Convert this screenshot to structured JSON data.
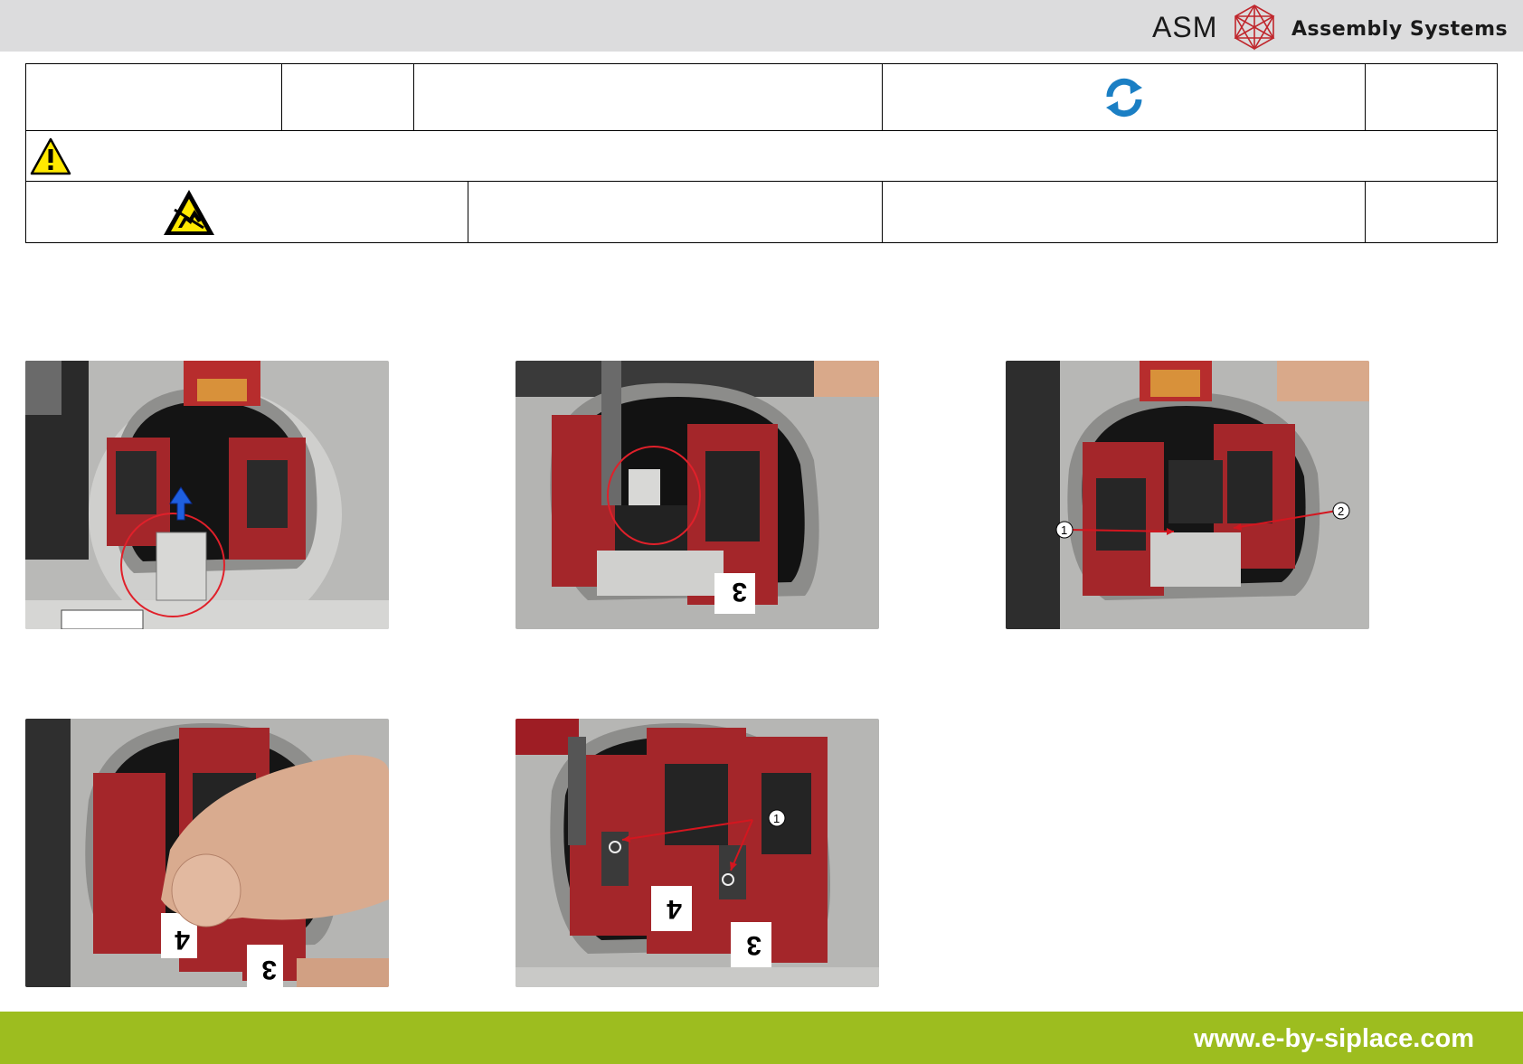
{
  "header": {
    "brand_short": "ASM",
    "brand_name": "Assembly Systems"
  },
  "info_table": {
    "row1": [
      "",
      "",
      "",
      "",
      ""
    ],
    "row1_icon": "refresh-icon",
    "row2_icon": "warning-icon",
    "row3_icon": "esd-warning-icon",
    "row3": [
      "",
      "",
      "",
      ""
    ]
  },
  "photos": [
    {
      "id": "photo-1",
      "callouts": []
    },
    {
      "id": "photo-2",
      "callouts": []
    },
    {
      "id": "photo-3",
      "callouts": [
        "1",
        "2"
      ]
    },
    {
      "id": "photo-4",
      "callouts": []
    },
    {
      "id": "photo-5",
      "callouts": [
        "1"
      ]
    }
  ],
  "photo_labels": {
    "photo2_board": "3",
    "photo4_board_a": "4",
    "photo4_board_b": "3",
    "photo5_board_a": "4",
    "photo5_board_b": "3"
  },
  "footer": {
    "url": "www.e-by-siplace.com"
  },
  "colors": {
    "header_bg": "#dcdcdd",
    "footer_bg": "#9dbd1f",
    "logo_red": "#c0272d",
    "refresh_blue": "#1b7fc4",
    "warning_yellow": "#ffe800"
  }
}
